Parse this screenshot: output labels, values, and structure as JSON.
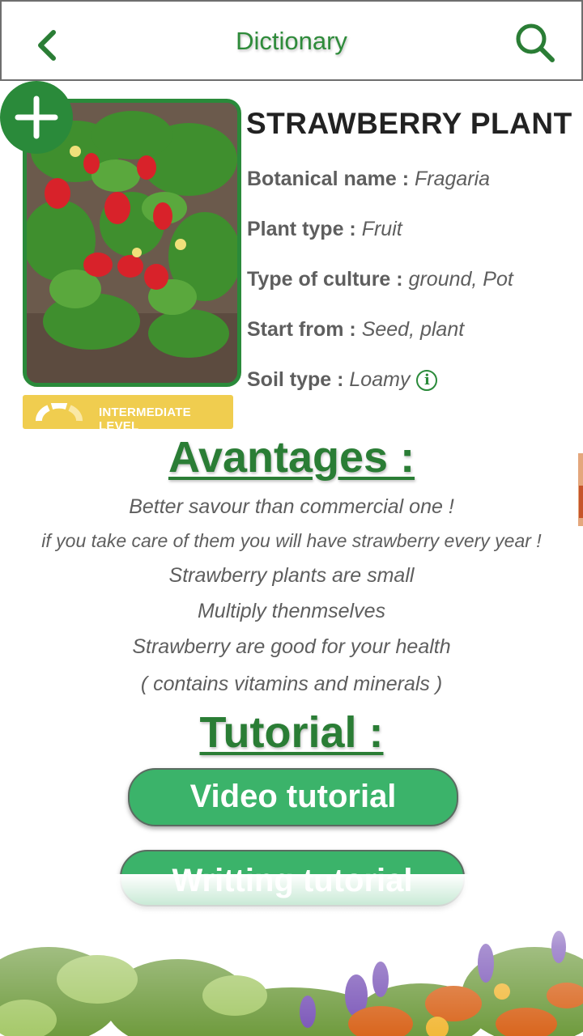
{
  "header": {
    "title": "Dictionary"
  },
  "plant": {
    "name": "STRAWBERRY PLANT",
    "level": "INTERMEDIATE LEVEL",
    "info": [
      {
        "key": "Botanical name : ",
        "value": "Fragaria"
      },
      {
        "key": "Plant type : ",
        "value": "Fruit"
      },
      {
        "key": "Type of culture : ",
        "value": "ground, Pot"
      },
      {
        "key": "Start from : ",
        "value": "Seed, plant"
      },
      {
        "key": "Soil type : ",
        "value": "Loamy"
      }
    ]
  },
  "advantages": {
    "title": "Avantages :",
    "lines": [
      "Better savour than commercial one !",
      "if you take care of them you will have strawberry every year !",
      "Strawberry plants are small",
      "Multiply thenmselves",
      "Strawberry are good for your health",
      "( contains vitamins and minerals )"
    ]
  },
  "tutorial": {
    "title": "Tutorial :",
    "video_label": "Video tutorial",
    "writing_label": "Writting tutorial"
  },
  "icons": {
    "back": "chevron-left-icon",
    "search": "search-icon",
    "add": "plus-icon",
    "info": "info-icon",
    "level": "gauge-icon"
  },
  "colors": {
    "primary_green": "#2a8a3a",
    "button_green": "#3bb36a",
    "badge_yellow": "#f0cd4f"
  }
}
